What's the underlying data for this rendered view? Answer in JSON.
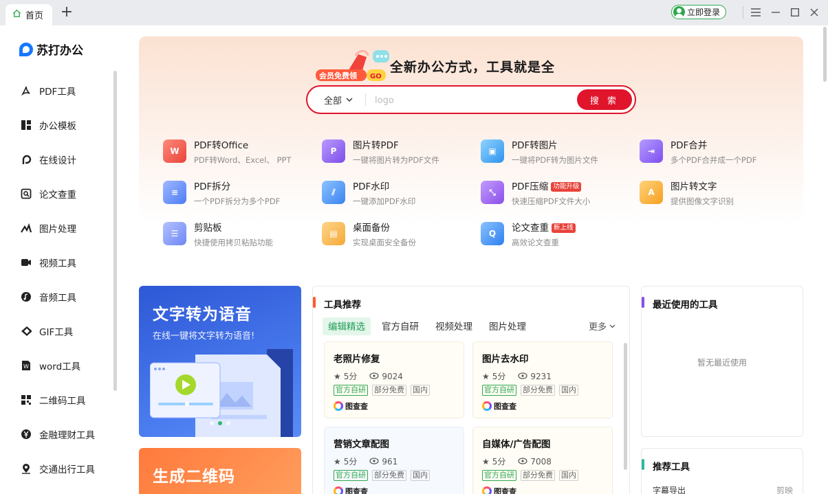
{
  "titlebar": {
    "tab_label": "首页",
    "add_tab": "+",
    "login_label": "立即登录"
  },
  "brand": {
    "name": "苏打办公"
  },
  "sidebar": {
    "items": [
      {
        "label": "PDF工具",
        "icon": "pdf-icon"
      },
      {
        "label": "办公模板",
        "icon": "template-icon"
      },
      {
        "label": "在线设计",
        "icon": "design-icon"
      },
      {
        "label": "论文查重",
        "icon": "paper-check-icon"
      },
      {
        "label": "图片处理",
        "icon": "image-icon"
      },
      {
        "label": "视频工具",
        "icon": "video-icon"
      },
      {
        "label": "音频工具",
        "icon": "audio-icon"
      },
      {
        "label": "GIF工具",
        "icon": "gif-icon"
      },
      {
        "label": "word工具",
        "icon": "word-icon"
      },
      {
        "label": "二维码工具",
        "icon": "qrcode-icon"
      },
      {
        "label": "金融理财工具",
        "icon": "finance-icon"
      },
      {
        "label": "交通出行工具",
        "icon": "location-icon"
      }
    ]
  },
  "hero": {
    "badge_text": "会员免费领",
    "badge_go": "GO",
    "title": "全新办公方式，工具就是全",
    "search": {
      "scope": "全部",
      "placeholder": "logo",
      "button": "搜 索"
    }
  },
  "tools": [
    {
      "name": "PDF转Office",
      "desc": "PDF转Word、Excel、 PPT",
      "color": "#ef4b4b",
      "glyph": "W",
      "tag": ""
    },
    {
      "name": "图片转PDF",
      "desc": "一键将图片转为PDF文件",
      "color": "#8a5cf0",
      "glyph": "P",
      "tag": ""
    },
    {
      "name": "PDF转图片",
      "desc": "一键将PDF转为图片文件",
      "color": "#39a5f0",
      "glyph": "▣",
      "tag": ""
    },
    {
      "name": "PDF合并",
      "desc": "多个PDF合并成一个PDF",
      "color": "#8a5cf0",
      "glyph": "⇥",
      "tag": ""
    },
    {
      "name": "PDF拆分",
      "desc": "一个PDF拆分为多个PDF",
      "color": "#4d7cf5",
      "glyph": "≡",
      "tag": ""
    },
    {
      "name": "PDF水印",
      "desc": "一键添加PDF水印",
      "color": "#3f8cf2",
      "glyph": "⫽",
      "tag": ""
    },
    {
      "name": "PDF压缩",
      "desc": "快速压缩PDF文件大小",
      "color": "#9a57ee",
      "glyph": "⤡",
      "tag": "功能升级"
    },
    {
      "name": "图片转文字",
      "desc": "提供图像文字识别",
      "color": "#f7a928",
      "glyph": "A",
      "tag": ""
    },
    {
      "name": "剪贴板",
      "desc": "快捷使用拷贝粘贴功能",
      "color": "#6e86f5",
      "glyph": "☰",
      "tag": ""
    },
    {
      "name": "桌面备份",
      "desc": "实现桌面安全备份",
      "color": "#f5a937",
      "glyph": "▤",
      "tag": ""
    },
    {
      "name": "论文查重",
      "desc": "高效论文查重",
      "color": "#3c8df2",
      "glyph": "Q",
      "tag": "新上线"
    }
  ],
  "banners": [
    {
      "title": "文字转为语音",
      "subtitle": "在线一键将文字转为语音!"
    },
    {
      "title": "生成二维码"
    }
  ],
  "recommend": {
    "title": "工具推荐",
    "tabs": [
      "编辑精选",
      "官方自研",
      "视频处理",
      "图片处理"
    ],
    "more": "更多",
    "cards": [
      {
        "name": "老照片修复",
        "rating": "5分",
        "views": "9024",
        "badges": [
          "官方自研",
          "部分免费",
          "国内"
        ],
        "source": "图查查"
      },
      {
        "name": "图片去水印",
        "rating": "5分",
        "views": "9231",
        "badges": [
          "官方自研",
          "部分免费",
          "国内"
        ],
        "source": "图查查"
      },
      {
        "name": "营销文章配图",
        "rating": "5分",
        "views": "961",
        "badges": [
          "官方自研",
          "部分免费",
          "国内"
        ],
        "source": "图查查"
      },
      {
        "name": "自媒体/广告配图",
        "rating": "5分",
        "views": "7008",
        "badges": [
          "官方自研",
          "部分免费",
          "国内"
        ],
        "source": "图查查"
      }
    ]
  },
  "recent": {
    "title": "最近使用的工具",
    "empty": "暂无最近使用"
  },
  "recommended_tools": {
    "title": "推荐工具",
    "first_item": "字幕导出",
    "first_item_right": "剪映"
  },
  "colors": {
    "accent_red": "#e0142b",
    "brand_blue": "#1677ff",
    "green": "#2fa84f"
  }
}
